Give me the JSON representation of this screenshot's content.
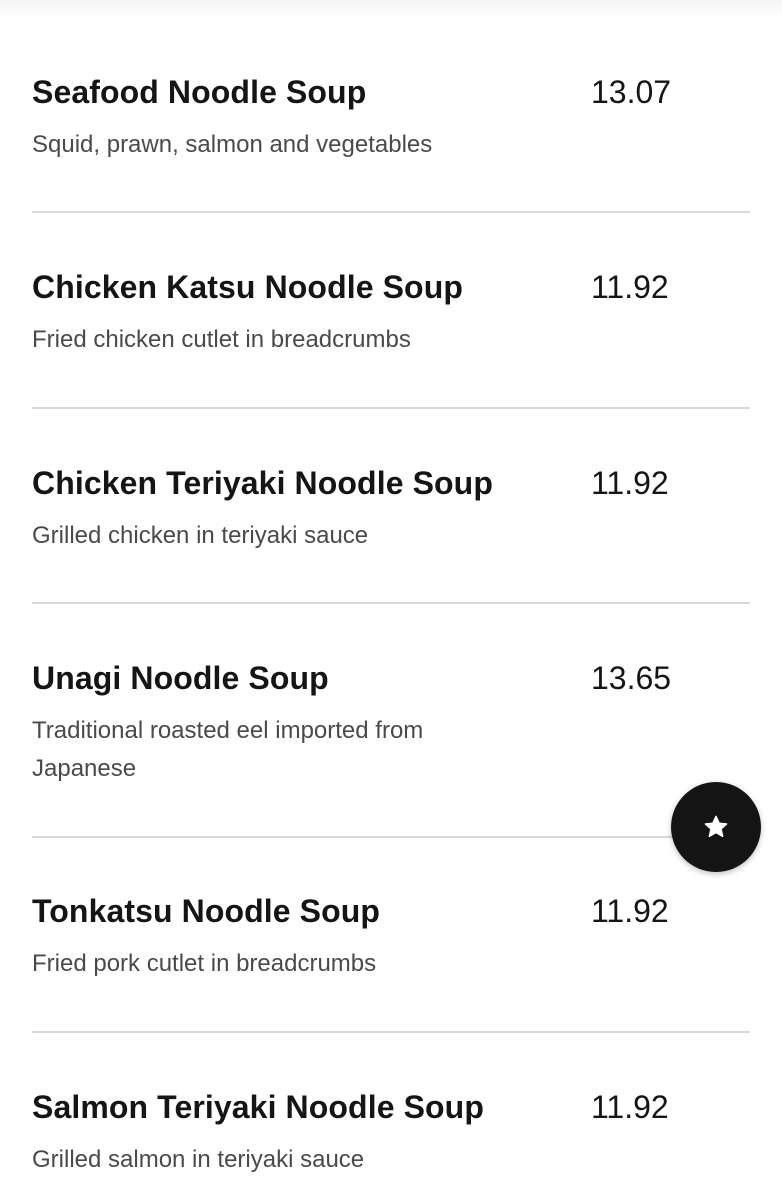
{
  "menu": {
    "items": [
      {
        "name": "Seafood Noodle Soup",
        "description": "Squid, prawn, salmon and vegetables",
        "price": "13.07"
      },
      {
        "name": "Chicken Katsu Noodle Soup",
        "description": "Fried chicken cutlet in breadcrumbs",
        "price": "11.92"
      },
      {
        "name": "Chicken Teriyaki Noodle Soup",
        "description": "Grilled chicken in teriyaki sauce",
        "price": "11.92"
      },
      {
        "name": "Unagi Noodle Soup",
        "description": "Traditional roasted eel imported from Japanese",
        "price": "13.65"
      },
      {
        "name": "Tonkatsu Noodle Soup",
        "description": "Fried pork cutlet in breadcrumbs",
        "price": "11.92"
      },
      {
        "name": "Salmon Teriyaki Noodle Soup",
        "description": "Grilled salmon in teriyaki sauce",
        "price": "11.92"
      }
    ]
  },
  "fab": {
    "icon": "star-icon",
    "background": "#141414",
    "icon_color": "#ffffff"
  },
  "colors": {
    "divider": "#d9d9d9",
    "text": "#151515",
    "muted": "#4a4a4a"
  }
}
